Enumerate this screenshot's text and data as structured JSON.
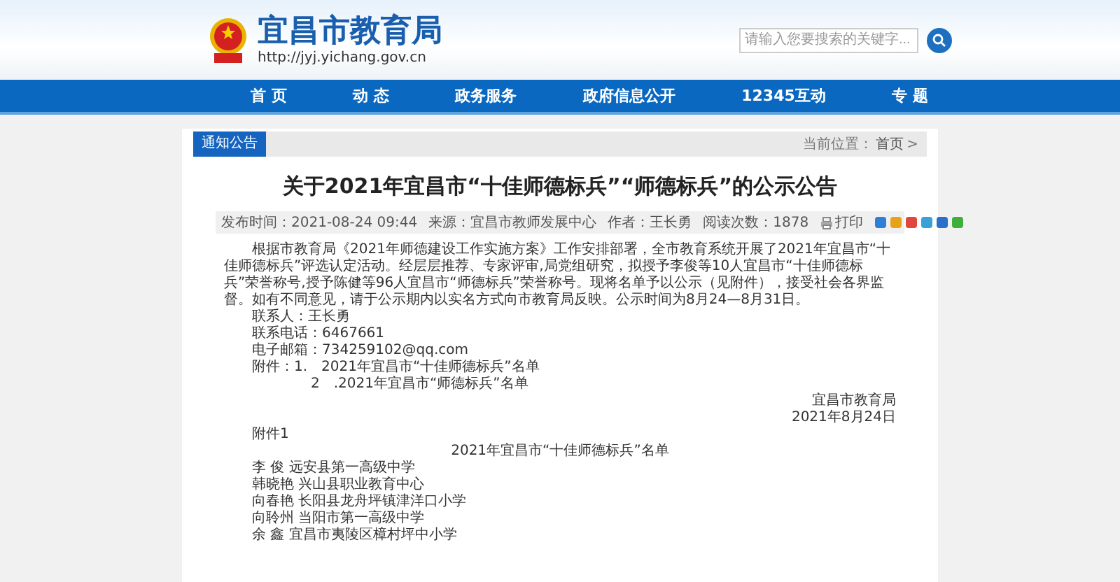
{
  "header": {
    "site_name": "宜昌市教育局",
    "url": "http://jyj.yichang.gov.cn",
    "search": {
      "placeholder": "请输入您要搜索的关键字..."
    }
  },
  "nav": [
    {
      "label": "首 页",
      "selected": false
    },
    {
      "label": "动 态",
      "selected": false
    },
    {
      "label": "政务服务",
      "selected": false
    },
    {
      "label": "政府信息公开",
      "selected": false
    },
    {
      "label": "12345互动",
      "selected": false
    },
    {
      "label": "专 题",
      "selected": false
    }
  ],
  "section": {
    "title": "通知公告",
    "breadcrumb_label": "当前位置：",
    "breadcrumb_link": "首页",
    "breadcrumb_sep": ">"
  },
  "article": {
    "title": "关于2021年宜昌市“十佳师德标兵”“师德标兵”的公示公告",
    "meta": [
      "发布时间：2021-08-24 09:44",
      "来源：宜昌市教师发展中心",
      "作者：王长勇",
      "阅读次数：1878"
    ],
    "print": "打印",
    "share": [
      {
        "color": "#2f7fd8"
      },
      {
        "color": "#e8a21a"
      },
      {
        "color": "#e0463c"
      },
      {
        "color": "#3aa0d8"
      },
      {
        "color": "#2a6fc9"
      },
      {
        "color": "#3fae3a"
      }
    ],
    "body": "根据市教育局《2021年师德建设工作实施方案》工作安排部署，全市教育系统开展了2021年宜昌市“十佳师德标兵”评选认定活动。经层层推荐、专家评审,局党组研究，拟授予李俊等10人宜昌市“十佳师德标兵”荣誉称号,授予陈健等96人宜昌市“师德标兵”荣誉称号。现将名单予以公示（见附件），接受社会各界监督。如有不同意见，请于公示期内以实名方式向市教育局反映。公示时间为8月24—8月31日。",
    "contact": [
      "联系人：王长勇",
      "联系电话：6467661",
      "电子邮箱：734259102@qq.com",
      "附件：1.　2021年宜昌市“十佳师德标兵”名单",
      "2　.2021年宜昌市“师德标兵”名单"
    ],
    "signature": [
      "宜昌市教育局",
      "2021年8月24日"
    ],
    "attachment_label": "附件1",
    "list_title": "2021年宜昌市“十佳师德标兵”名单",
    "names": [
      "李 俊 远安县第一高级中学",
      "韩晓艳 兴山县职业教育中心",
      "向春艳 长阳县龙舟坪镇津洋口小学",
      "向聆州 当阳市第一高级中学",
      "余 鑫 宜昌市夷陵区樟村坪中小学"
    ]
  }
}
